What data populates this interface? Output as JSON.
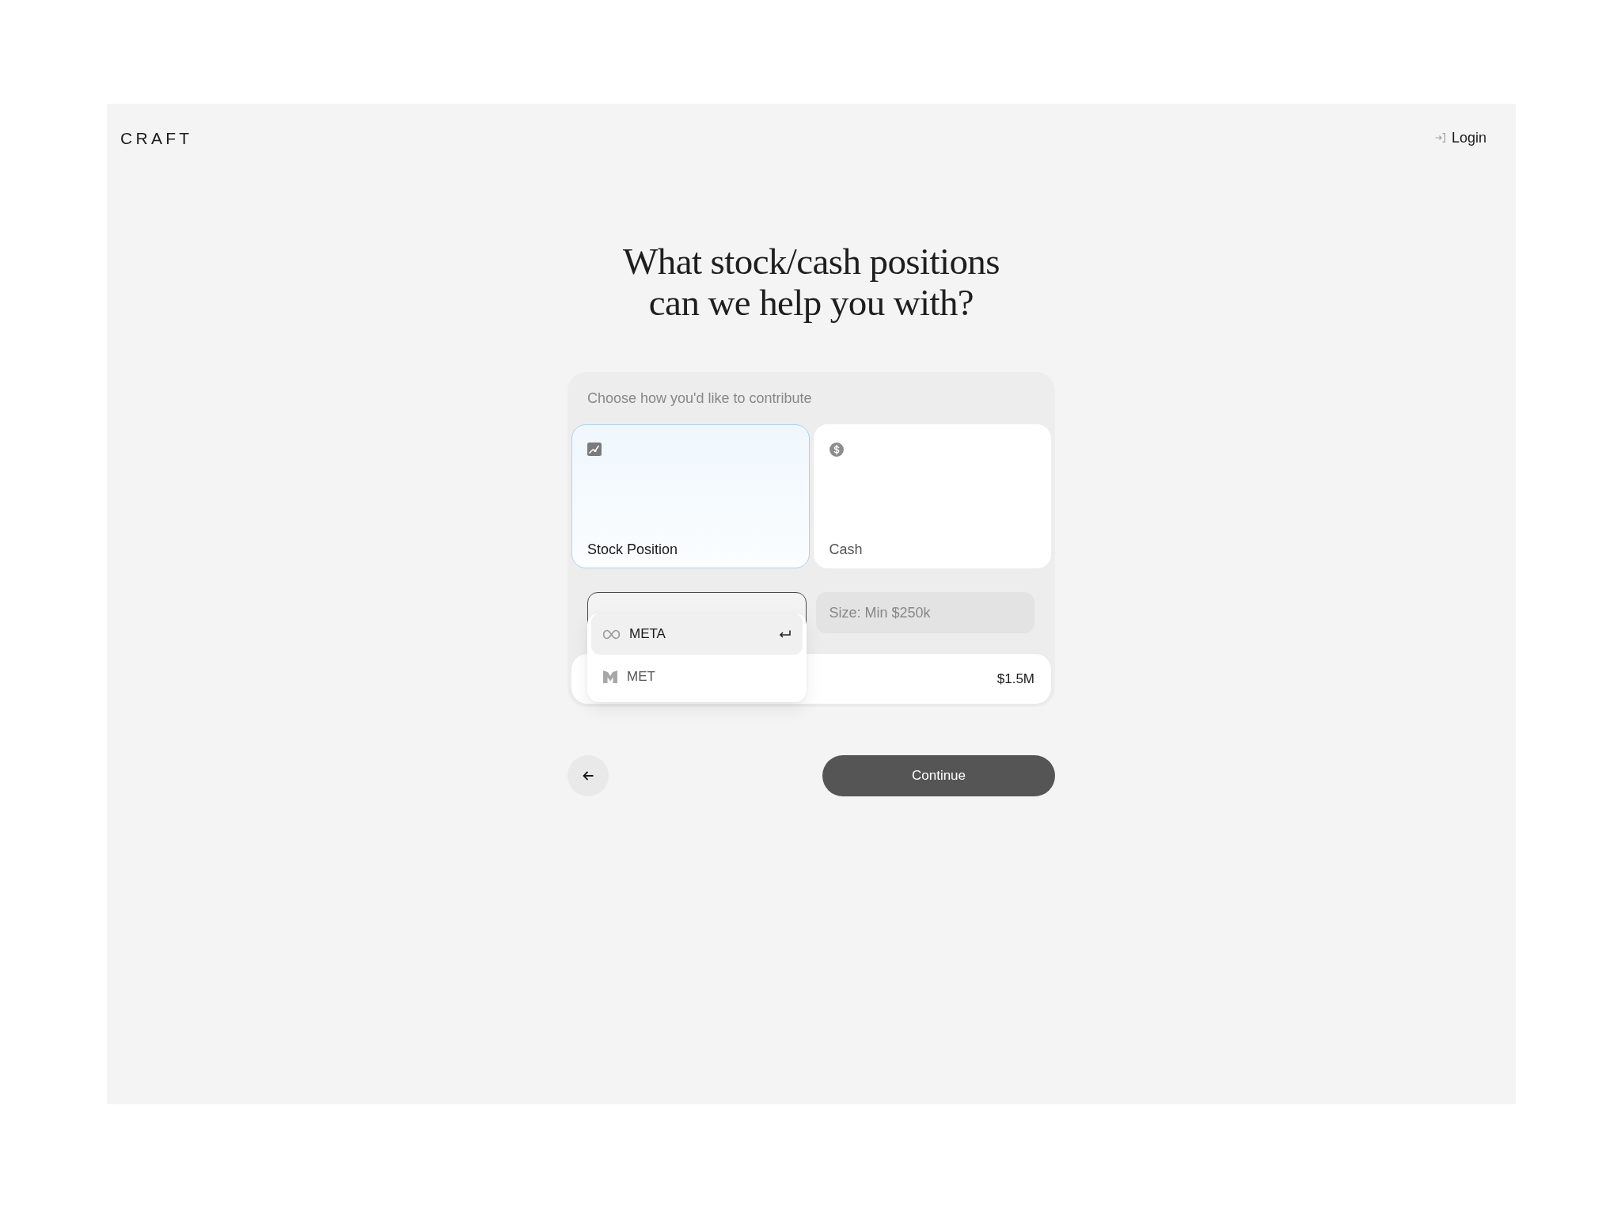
{
  "header": {
    "logo": "CRAFT",
    "login": "Login"
  },
  "heading": {
    "lines": [
      "What stock/cash positions",
      "can we help you with?"
    ]
  },
  "form": {
    "prompt": "Choose how you'd like to contribute",
    "options": [
      {
        "kind": "stock",
        "label": "Stock Position",
        "selected": true
      },
      {
        "kind": "cash",
        "label": "Cash",
        "selected": false
      }
    ],
    "ticker_field": {
      "focused": true
    },
    "suggestions": [
      {
        "kind": "meta",
        "label": "META",
        "selected": true
      },
      {
        "kind": "met",
        "label": "MET",
        "selected": false
      }
    ],
    "size_field": {
      "placeholder": "Size: Min $250k"
    },
    "amount": "$1.5M"
  },
  "actions": {
    "continue": "Continue"
  }
}
